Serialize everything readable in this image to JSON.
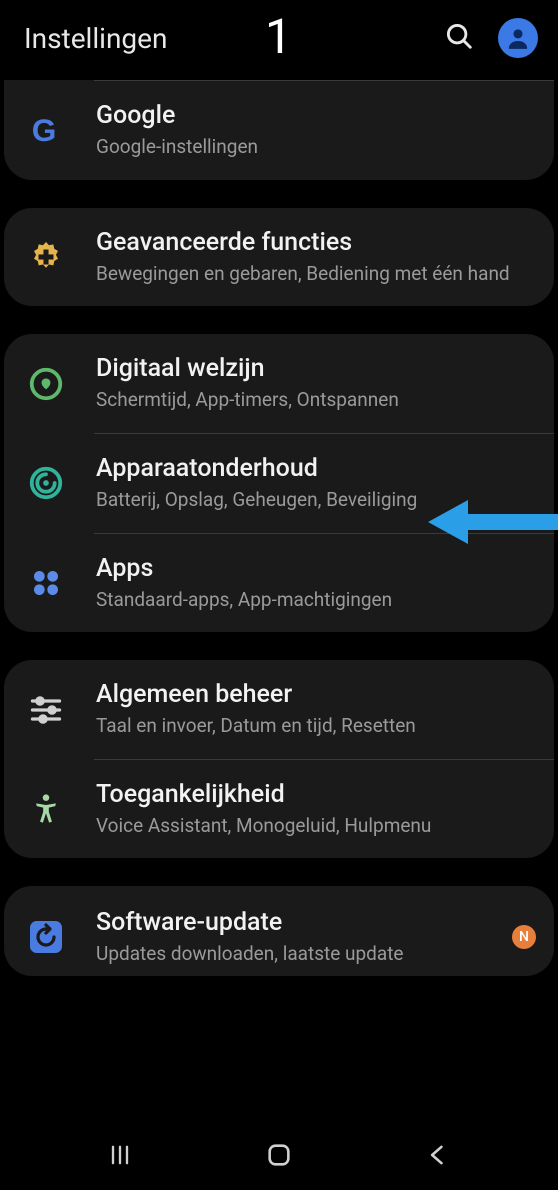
{
  "header": {
    "title": "Instellingen",
    "step": "1"
  },
  "groups": [
    {
      "items": [
        {
          "title": "Google",
          "sub": "Google-instellingen",
          "icon": "google",
          "icon_color": "#4a7be0"
        }
      ]
    },
    {
      "items": [
        {
          "title": "Geavanceerde functies",
          "sub": "Bewegingen en gebaren, Bediening met één hand",
          "icon": "gear-plus",
          "icon_color": "#e6b44c"
        }
      ]
    },
    {
      "items": [
        {
          "title": "Digitaal welzijn",
          "sub": "Schermtijd, App-timers, Ontspannen",
          "icon": "wellbeing",
          "icon_color": "#5fb86a"
        },
        {
          "title": "Apparaatonderhoud",
          "sub": "Batterij, Opslag, Geheugen, Beveiliging",
          "icon": "maintenance",
          "icon_color": "#2fb39a"
        },
        {
          "title": "Apps",
          "sub": "Standaard-apps, App-machtigingen",
          "icon": "apps",
          "icon_color": "#5b8be6"
        }
      ]
    },
    {
      "items": [
        {
          "title": "Algemeen beheer",
          "sub": "Taal en invoer, Datum en tijd, Resetten",
          "icon": "sliders",
          "icon_color": "#d0d0d0"
        },
        {
          "title": "Toegankelijkheid",
          "sub": "Voice Assistant, Monogeluid, Hulpmenu",
          "icon": "accessibility",
          "icon_color": "#a6d9a6"
        }
      ]
    },
    {
      "items": [
        {
          "title": "Software-update",
          "sub": "Updates downloaden, laatste update",
          "icon": "update",
          "icon_color": "#4a7be0",
          "badge": "N"
        }
      ]
    }
  ]
}
